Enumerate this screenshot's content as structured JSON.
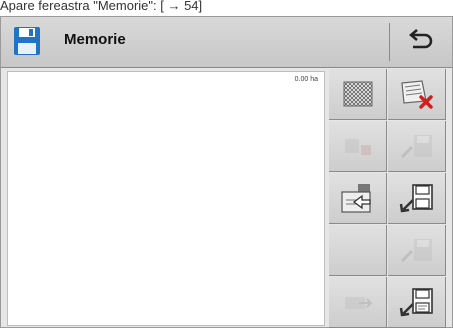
{
  "caption": "Apare fereastra \"Memorie\": [ → 54]",
  "window": {
    "title": "Memorie",
    "title_icon": "floppy-disk-icon",
    "back_icon": "back-arrow-icon"
  },
  "map": {
    "area_value": "0.00 ha"
  },
  "softkeys": [
    {
      "icon": "pattern-grid-icon",
      "enabled": true
    },
    {
      "icon": "delete-map-icon",
      "enabled": true
    },
    {
      "icon": "disabled-import-icon",
      "enabled": false
    },
    {
      "icon": "disabled-save-icon",
      "enabled": false
    },
    {
      "icon": "export-to-usb-icon",
      "enabled": true
    },
    {
      "icon": "save-to-usb-icon",
      "enabled": true
    },
    {
      "icon": "empty-slot",
      "enabled": false
    },
    {
      "icon": "disabled-save-icon",
      "enabled": false
    },
    {
      "icon": "disabled-transfer-icon",
      "enabled": false
    },
    {
      "icon": "save-as-icon",
      "enabled": true
    }
  ],
  "colors": {
    "title_icon_blue": "#1f74c8",
    "delete_red": "#d0201d"
  }
}
